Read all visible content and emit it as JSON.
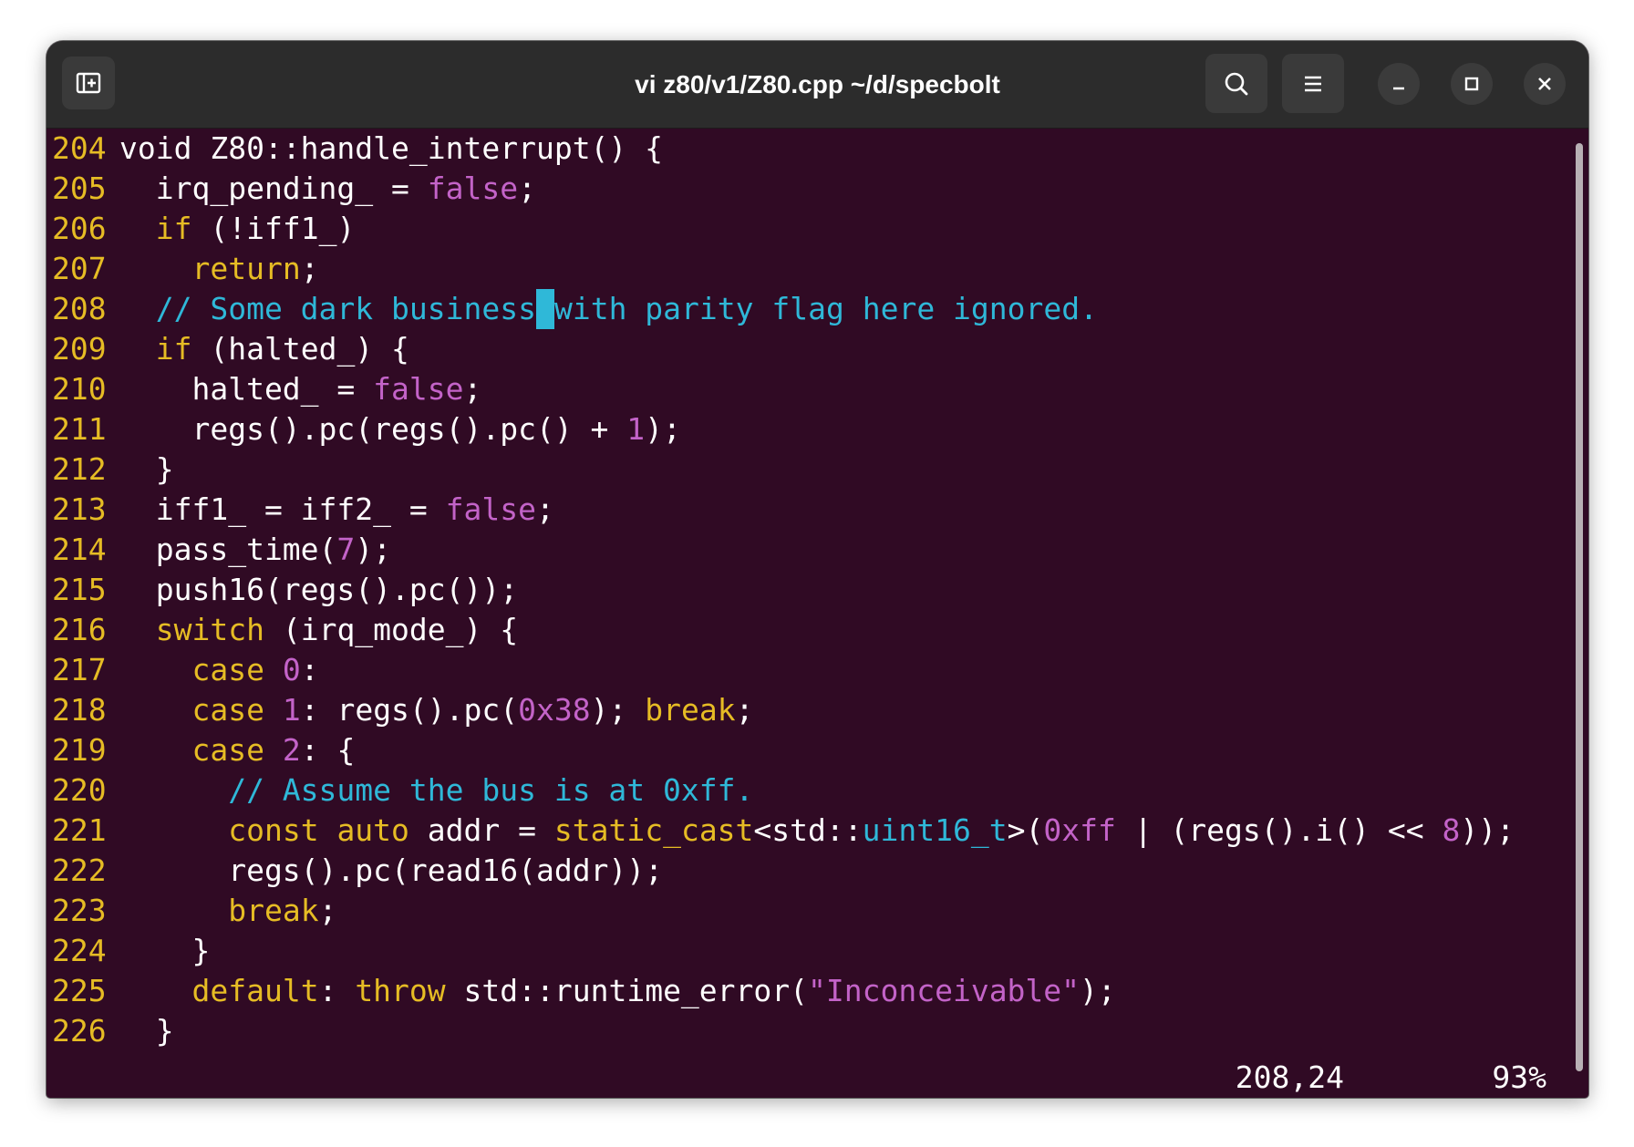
{
  "window": {
    "title": "vi z80/v1/Z80.cpp ~/d/specbolt",
    "buttons": {
      "new_tab": "new-tab-icon",
      "search": "search-icon",
      "menu": "hamburger-menu-icon",
      "minimize": "minimize-icon",
      "maximize": "maximize-icon",
      "close": "close-icon"
    }
  },
  "colors": {
    "background": "#300a24",
    "line_number": "#e6bc24",
    "keyword": "#e6bc24",
    "comment": "#2fb8d8",
    "literal": "#c363c8",
    "text": "#ffffff",
    "cursor": "#2fb8d8"
  },
  "editor": {
    "lines": [
      {
        "num": "204",
        "tokens": [
          {
            "t": "void Z80::handle_interrupt() {",
            "c": "p"
          }
        ]
      },
      {
        "num": "205",
        "tokens": [
          {
            "t": "  irq_pending_ = ",
            "c": "p"
          },
          {
            "t": "false",
            "c": "n"
          },
          {
            "t": ";",
            "c": "p"
          }
        ]
      },
      {
        "num": "206",
        "tokens": [
          {
            "t": "  ",
            "c": "p"
          },
          {
            "t": "if",
            "c": "k"
          },
          {
            "t": " (!iff1_)",
            "c": "p"
          }
        ]
      },
      {
        "num": "207",
        "tokens": [
          {
            "t": "    ",
            "c": "p"
          },
          {
            "t": "return",
            "c": "k"
          },
          {
            "t": ";",
            "c": "p"
          }
        ]
      },
      {
        "num": "208",
        "tokens": [
          {
            "t": "  // Some dark business",
            "c": "c"
          },
          {
            "t": " ",
            "c": "cursor"
          },
          {
            "t": "with parity flag here ignored.",
            "c": "c"
          }
        ]
      },
      {
        "num": "209",
        "tokens": [
          {
            "t": "  ",
            "c": "p"
          },
          {
            "t": "if",
            "c": "k"
          },
          {
            "t": " (halted_) {",
            "c": "p"
          }
        ]
      },
      {
        "num": "210",
        "tokens": [
          {
            "t": "    halted_ = ",
            "c": "p"
          },
          {
            "t": "false",
            "c": "n"
          },
          {
            "t": ";",
            "c": "p"
          }
        ]
      },
      {
        "num": "211",
        "tokens": [
          {
            "t": "    regs().pc(regs().pc() + ",
            "c": "p"
          },
          {
            "t": "1",
            "c": "n"
          },
          {
            "t": ");",
            "c": "p"
          }
        ]
      },
      {
        "num": "212",
        "tokens": [
          {
            "t": "  }",
            "c": "p"
          }
        ]
      },
      {
        "num": "213",
        "tokens": [
          {
            "t": "  iff1_ = iff2_ = ",
            "c": "p"
          },
          {
            "t": "false",
            "c": "n"
          },
          {
            "t": ";",
            "c": "p"
          }
        ]
      },
      {
        "num": "214",
        "tokens": [
          {
            "t": "  pass_time(",
            "c": "p"
          },
          {
            "t": "7",
            "c": "n"
          },
          {
            "t": ");",
            "c": "p"
          }
        ]
      },
      {
        "num": "215",
        "tokens": [
          {
            "t": "  push16(regs().pc());",
            "c": "p"
          }
        ]
      },
      {
        "num": "216",
        "tokens": [
          {
            "t": "  ",
            "c": "p"
          },
          {
            "t": "switch",
            "c": "k"
          },
          {
            "t": " (irq_mode_) {",
            "c": "p"
          }
        ]
      },
      {
        "num": "217",
        "tokens": [
          {
            "t": "    ",
            "c": "p"
          },
          {
            "t": "case",
            "c": "k"
          },
          {
            "t": " ",
            "c": "p"
          },
          {
            "t": "0",
            "c": "n"
          },
          {
            "t": ":",
            "c": "p"
          }
        ]
      },
      {
        "num": "218",
        "tokens": [
          {
            "t": "    ",
            "c": "p"
          },
          {
            "t": "case",
            "c": "k"
          },
          {
            "t": " ",
            "c": "p"
          },
          {
            "t": "1",
            "c": "n"
          },
          {
            "t": ": regs().pc(",
            "c": "p"
          },
          {
            "t": "0x38",
            "c": "n"
          },
          {
            "t": "); ",
            "c": "p"
          },
          {
            "t": "break",
            "c": "k"
          },
          {
            "t": ";",
            "c": "p"
          }
        ]
      },
      {
        "num": "219",
        "tokens": [
          {
            "t": "    ",
            "c": "p"
          },
          {
            "t": "case",
            "c": "k"
          },
          {
            "t": " ",
            "c": "p"
          },
          {
            "t": "2",
            "c": "n"
          },
          {
            "t": ": {",
            "c": "p"
          }
        ]
      },
      {
        "num": "220",
        "tokens": [
          {
            "t": "      // Assume the bus is at 0xff.",
            "c": "c"
          }
        ]
      },
      {
        "num": "221",
        "tokens": [
          {
            "t": "      ",
            "c": "p"
          },
          {
            "t": "const",
            "c": "k"
          },
          {
            "t": " ",
            "c": "p"
          },
          {
            "t": "auto",
            "c": "k"
          },
          {
            "t": " addr = ",
            "c": "p"
          },
          {
            "t": "static_cast",
            "c": "k"
          },
          {
            "t": "<std::",
            "c": "p"
          },
          {
            "t": "uint16_t",
            "c": "c"
          },
          {
            "t": ">(",
            "c": "p"
          },
          {
            "t": "0xff",
            "c": "n"
          },
          {
            "t": " | (regs().i() << ",
            "c": "p"
          },
          {
            "t": "8",
            "c": "n"
          },
          {
            "t": "));",
            "c": "p"
          }
        ]
      },
      {
        "num": "222",
        "tokens": [
          {
            "t": "      regs().pc(read16(addr));",
            "c": "p"
          }
        ]
      },
      {
        "num": "223",
        "tokens": [
          {
            "t": "      ",
            "c": "p"
          },
          {
            "t": "break",
            "c": "k"
          },
          {
            "t": ";",
            "c": "p"
          }
        ]
      },
      {
        "num": "224",
        "tokens": [
          {
            "t": "    }",
            "c": "p"
          }
        ]
      },
      {
        "num": "225",
        "tokens": [
          {
            "t": "    ",
            "c": "p"
          },
          {
            "t": "default",
            "c": "k"
          },
          {
            "t": ": ",
            "c": "p"
          },
          {
            "t": "throw",
            "c": "k"
          },
          {
            "t": " std::runtime_error(",
            "c": "p"
          },
          {
            "t": "\"Inconceivable\"",
            "c": "n"
          },
          {
            "t": ");",
            "c": "p"
          }
        ]
      },
      {
        "num": "226",
        "tokens": [
          {
            "t": "  }",
            "c": "p"
          }
        ]
      }
    ]
  },
  "status": {
    "position": "208,24",
    "percent": "93%"
  }
}
